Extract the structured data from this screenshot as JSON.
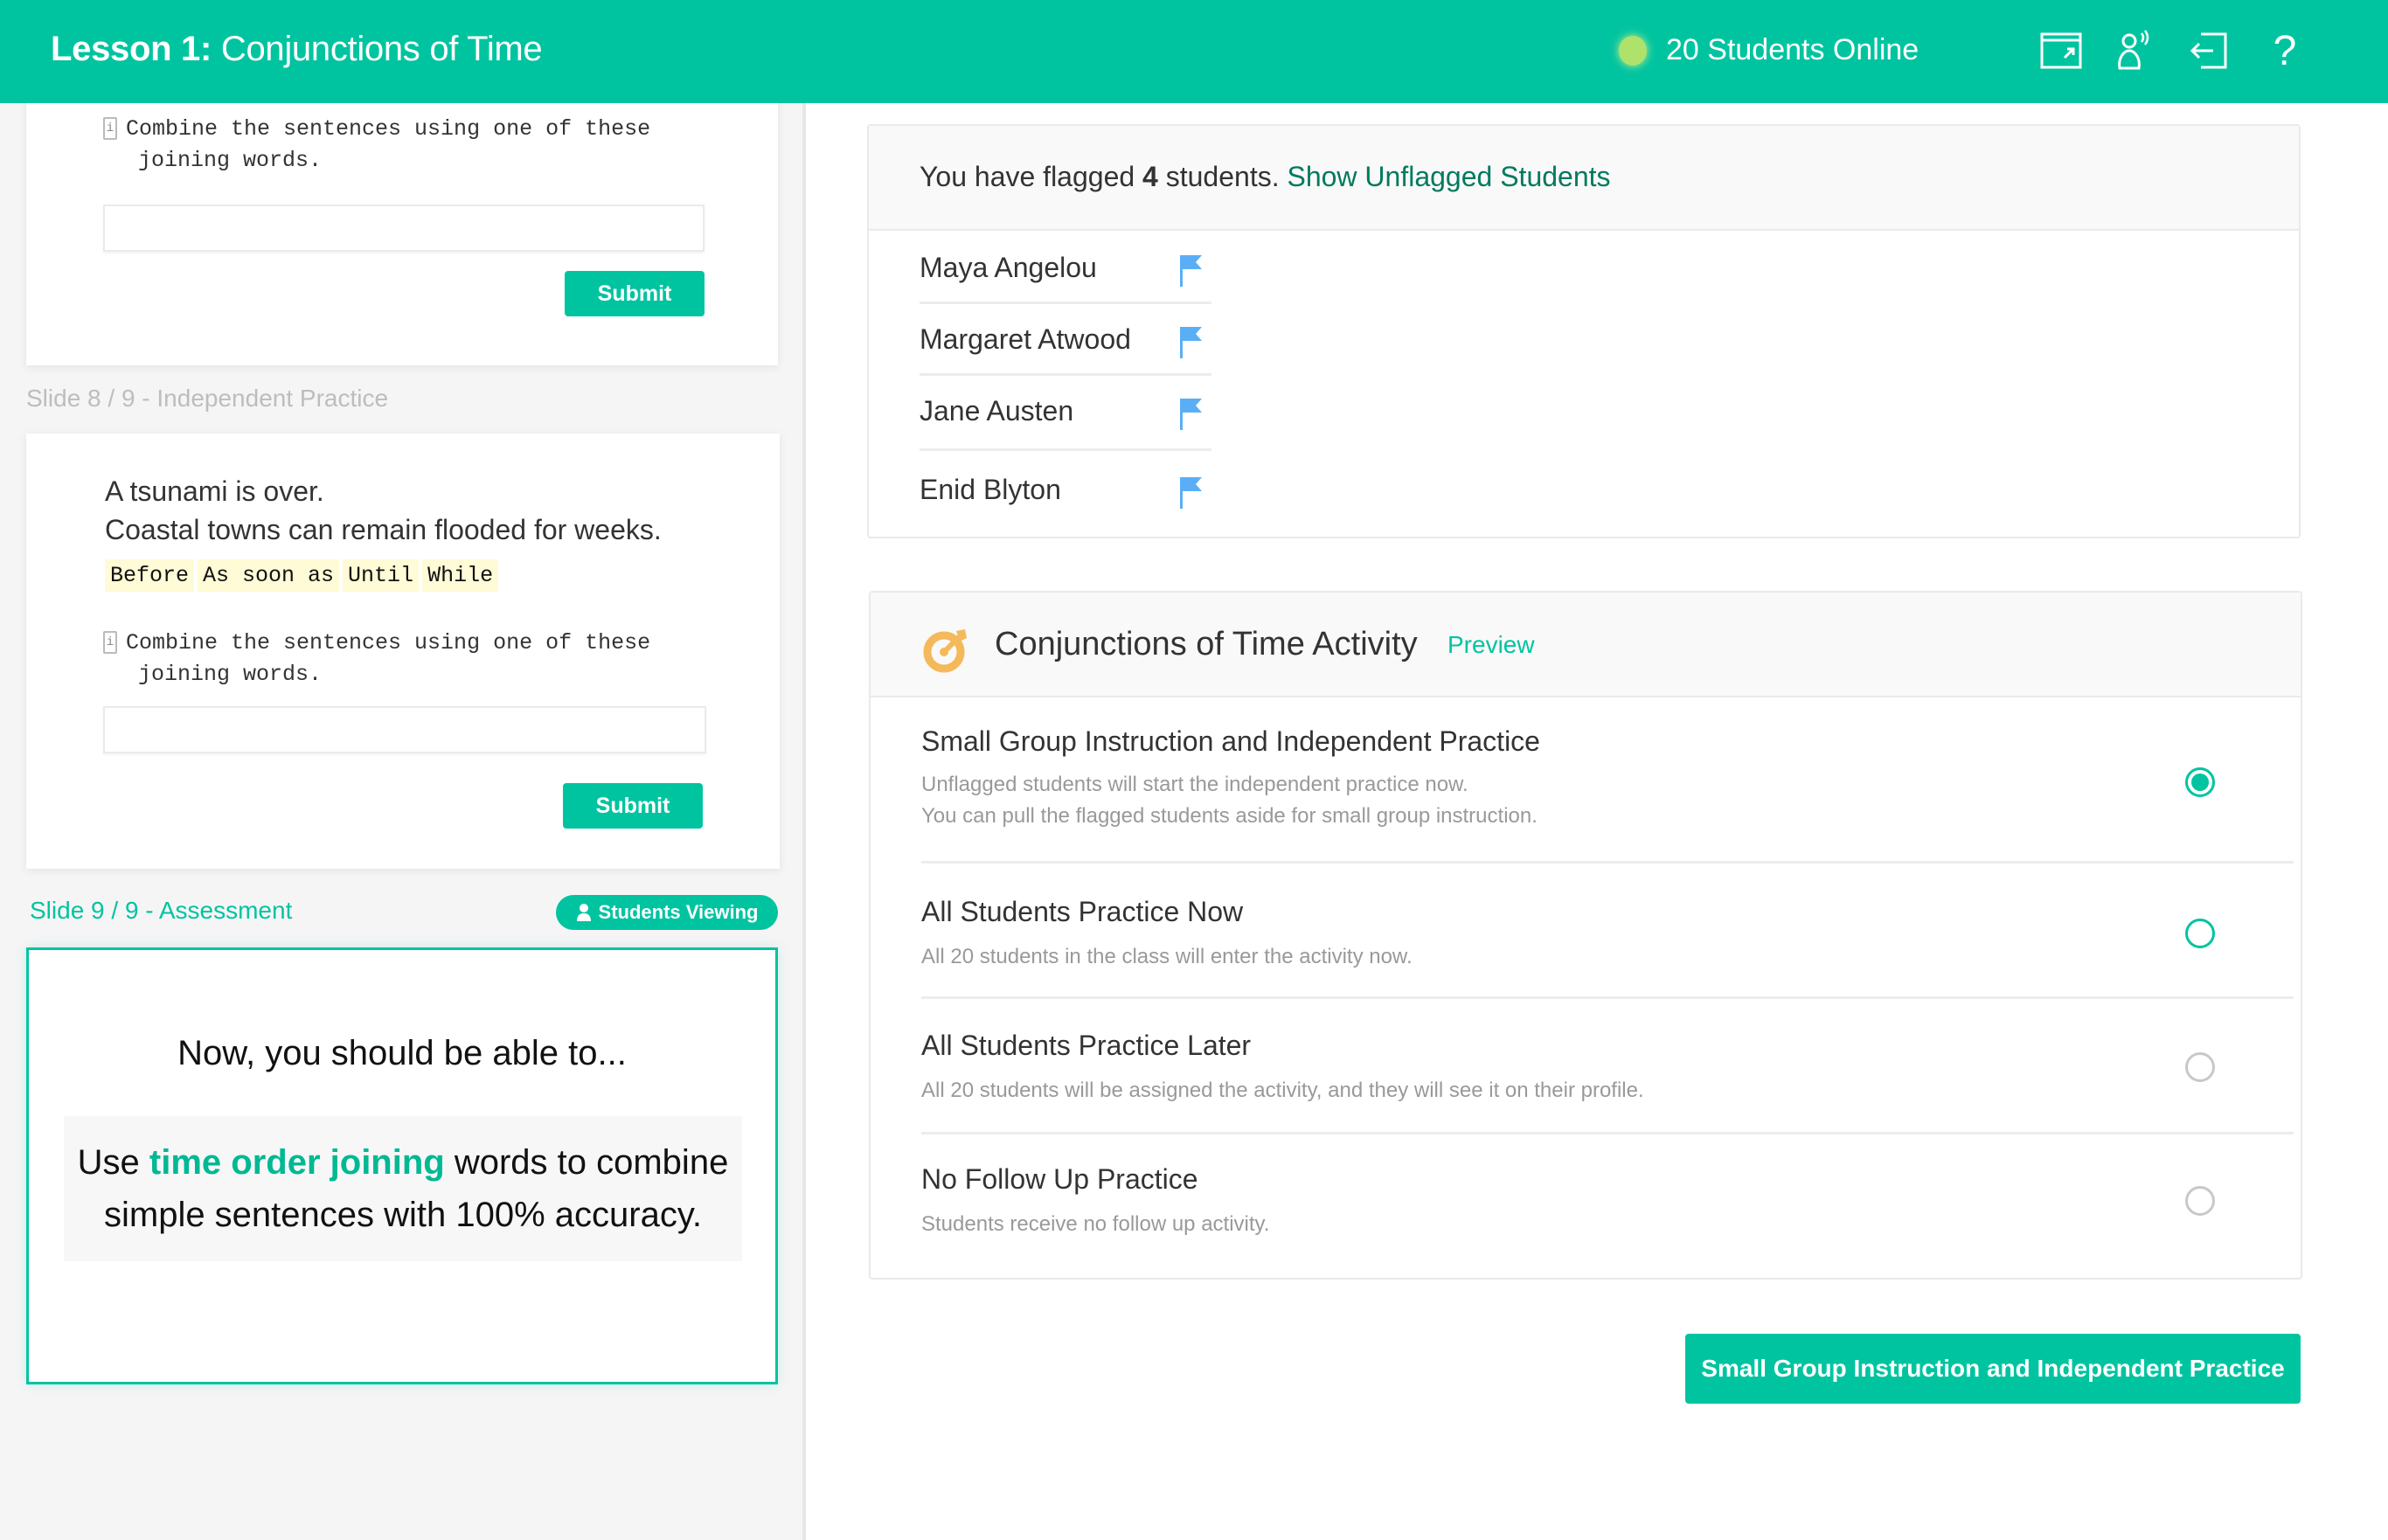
{
  "header": {
    "lesson_prefix": "Lesson 1:",
    "lesson_title": "Conjunctions of Time",
    "online_text": "20 Students Online",
    "icons": [
      "present-window-icon",
      "students-broadcast-icon",
      "exit-icon",
      "help-icon"
    ],
    "help_glyph": "?"
  },
  "colors": {
    "brand": "#00c4a0",
    "online_dot": "#aee26a",
    "flag": "#5aaef5",
    "link_dark": "#007a5e",
    "activity_icon": "#f4b95a",
    "chip_bg": "#fffbd6"
  },
  "slides": {
    "slide7": {
      "instruction": "Combine the sentences using one of these joining words.",
      "instruction_lines": [
        "Combine the sentences using one of these",
        "joining words."
      ],
      "input_value": "",
      "submit_label": "Submit"
    },
    "slide8": {
      "label": "Slide 8 / 9 - Independent Practice",
      "sentence1": "A tsunami is over.",
      "sentence2": "Coastal towns can remain flooded for weeks.",
      "chips": [
        "Before",
        "As soon as",
        "Until",
        "While"
      ],
      "instruction_lines": [
        "Combine the sentences using one of these",
        "joining words."
      ],
      "input_value": "",
      "submit_label": "Submit"
    },
    "slide9": {
      "label": "Slide 9 / 9 - Assessment",
      "badge": "Students Viewing",
      "heading": "Now, you should be able to...",
      "objective_prefix": "Use ",
      "objective_highlight": "time order joining",
      "objective_line1_suffix": " words to combine",
      "objective_line2": "simple sentences with 100% accuracy."
    }
  },
  "flagged": {
    "prefix": "You have flagged ",
    "count": "4",
    "suffix": " students. ",
    "link": "Show Unflagged Students",
    "students": [
      "Maya Angelou",
      "Margaret Atwood",
      "Jane Austen",
      "Enid Blyton"
    ]
  },
  "activity": {
    "title": "Conjunctions of Time Activity",
    "preview_label": "Preview",
    "selected_index": 0,
    "options": [
      {
        "title": "Small Group Instruction and Independent Practice",
        "desc": [
          "Unflagged students will start the independent practice now.",
          "You can pull the flagged students aside for small group instruction."
        ],
        "state": "checked"
      },
      {
        "title": "All Students Practice Now",
        "desc": [
          "All 20 students in the class will enter the activity now."
        ],
        "state": "hover"
      },
      {
        "title": "All Students Practice Later",
        "desc": [
          "All 20 students will be assigned the activity, and they will see it on their profile."
        ],
        "state": "unchecked"
      },
      {
        "title": "No Follow Up Practice",
        "desc": [
          "Students receive no follow up activity."
        ],
        "state": "unchecked"
      }
    ],
    "cta_label": "Small Group Instruction and Independent Practice"
  }
}
